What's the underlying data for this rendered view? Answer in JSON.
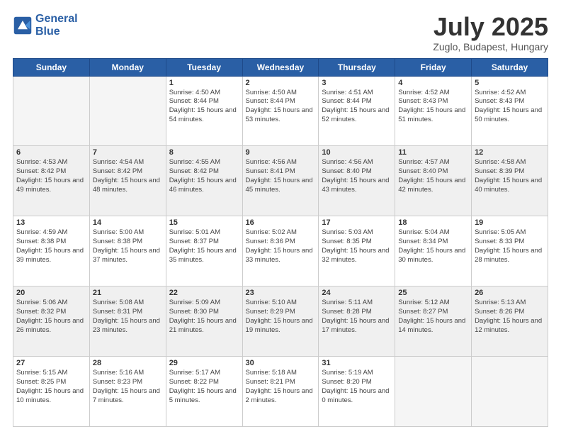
{
  "logo": {
    "line1": "General",
    "line2": "Blue"
  },
  "header": {
    "month_year": "July 2025",
    "location": "Zuglo, Budapest, Hungary"
  },
  "weekdays": [
    "Sunday",
    "Monday",
    "Tuesday",
    "Wednesday",
    "Thursday",
    "Friday",
    "Saturday"
  ],
  "weeks": [
    [
      {
        "day": "",
        "sunrise": "",
        "sunset": "",
        "daylight": ""
      },
      {
        "day": "",
        "sunrise": "",
        "sunset": "",
        "daylight": ""
      },
      {
        "day": "1",
        "sunrise": "Sunrise: 4:50 AM",
        "sunset": "Sunset: 8:44 PM",
        "daylight": "Daylight: 15 hours and 54 minutes."
      },
      {
        "day": "2",
        "sunrise": "Sunrise: 4:50 AM",
        "sunset": "Sunset: 8:44 PM",
        "daylight": "Daylight: 15 hours and 53 minutes."
      },
      {
        "day": "3",
        "sunrise": "Sunrise: 4:51 AM",
        "sunset": "Sunset: 8:44 PM",
        "daylight": "Daylight: 15 hours and 52 minutes."
      },
      {
        "day": "4",
        "sunrise": "Sunrise: 4:52 AM",
        "sunset": "Sunset: 8:43 PM",
        "daylight": "Daylight: 15 hours and 51 minutes."
      },
      {
        "day": "5",
        "sunrise": "Sunrise: 4:52 AM",
        "sunset": "Sunset: 8:43 PM",
        "daylight": "Daylight: 15 hours and 50 minutes."
      }
    ],
    [
      {
        "day": "6",
        "sunrise": "Sunrise: 4:53 AM",
        "sunset": "Sunset: 8:42 PM",
        "daylight": "Daylight: 15 hours and 49 minutes."
      },
      {
        "day": "7",
        "sunrise": "Sunrise: 4:54 AM",
        "sunset": "Sunset: 8:42 PM",
        "daylight": "Daylight: 15 hours and 48 minutes."
      },
      {
        "day": "8",
        "sunrise": "Sunrise: 4:55 AM",
        "sunset": "Sunset: 8:42 PM",
        "daylight": "Daylight: 15 hours and 46 minutes."
      },
      {
        "day": "9",
        "sunrise": "Sunrise: 4:56 AM",
        "sunset": "Sunset: 8:41 PM",
        "daylight": "Daylight: 15 hours and 45 minutes."
      },
      {
        "day": "10",
        "sunrise": "Sunrise: 4:56 AM",
        "sunset": "Sunset: 8:40 PM",
        "daylight": "Daylight: 15 hours and 43 minutes."
      },
      {
        "day": "11",
        "sunrise": "Sunrise: 4:57 AM",
        "sunset": "Sunset: 8:40 PM",
        "daylight": "Daylight: 15 hours and 42 minutes."
      },
      {
        "day": "12",
        "sunrise": "Sunrise: 4:58 AM",
        "sunset": "Sunset: 8:39 PM",
        "daylight": "Daylight: 15 hours and 40 minutes."
      }
    ],
    [
      {
        "day": "13",
        "sunrise": "Sunrise: 4:59 AM",
        "sunset": "Sunset: 8:38 PM",
        "daylight": "Daylight: 15 hours and 39 minutes."
      },
      {
        "day": "14",
        "sunrise": "Sunrise: 5:00 AM",
        "sunset": "Sunset: 8:38 PM",
        "daylight": "Daylight: 15 hours and 37 minutes."
      },
      {
        "day": "15",
        "sunrise": "Sunrise: 5:01 AM",
        "sunset": "Sunset: 8:37 PM",
        "daylight": "Daylight: 15 hours and 35 minutes."
      },
      {
        "day": "16",
        "sunrise": "Sunrise: 5:02 AM",
        "sunset": "Sunset: 8:36 PM",
        "daylight": "Daylight: 15 hours and 33 minutes."
      },
      {
        "day": "17",
        "sunrise": "Sunrise: 5:03 AM",
        "sunset": "Sunset: 8:35 PM",
        "daylight": "Daylight: 15 hours and 32 minutes."
      },
      {
        "day": "18",
        "sunrise": "Sunrise: 5:04 AM",
        "sunset": "Sunset: 8:34 PM",
        "daylight": "Daylight: 15 hours and 30 minutes."
      },
      {
        "day": "19",
        "sunrise": "Sunrise: 5:05 AM",
        "sunset": "Sunset: 8:33 PM",
        "daylight": "Daylight: 15 hours and 28 minutes."
      }
    ],
    [
      {
        "day": "20",
        "sunrise": "Sunrise: 5:06 AM",
        "sunset": "Sunset: 8:32 PM",
        "daylight": "Daylight: 15 hours and 26 minutes."
      },
      {
        "day": "21",
        "sunrise": "Sunrise: 5:08 AM",
        "sunset": "Sunset: 8:31 PM",
        "daylight": "Daylight: 15 hours and 23 minutes."
      },
      {
        "day": "22",
        "sunrise": "Sunrise: 5:09 AM",
        "sunset": "Sunset: 8:30 PM",
        "daylight": "Daylight: 15 hours and 21 minutes."
      },
      {
        "day": "23",
        "sunrise": "Sunrise: 5:10 AM",
        "sunset": "Sunset: 8:29 PM",
        "daylight": "Daylight: 15 hours and 19 minutes."
      },
      {
        "day": "24",
        "sunrise": "Sunrise: 5:11 AM",
        "sunset": "Sunset: 8:28 PM",
        "daylight": "Daylight: 15 hours and 17 minutes."
      },
      {
        "day": "25",
        "sunrise": "Sunrise: 5:12 AM",
        "sunset": "Sunset: 8:27 PM",
        "daylight": "Daylight: 15 hours and 14 minutes."
      },
      {
        "day": "26",
        "sunrise": "Sunrise: 5:13 AM",
        "sunset": "Sunset: 8:26 PM",
        "daylight": "Daylight: 15 hours and 12 minutes."
      }
    ],
    [
      {
        "day": "27",
        "sunrise": "Sunrise: 5:15 AM",
        "sunset": "Sunset: 8:25 PM",
        "daylight": "Daylight: 15 hours and 10 minutes."
      },
      {
        "day": "28",
        "sunrise": "Sunrise: 5:16 AM",
        "sunset": "Sunset: 8:23 PM",
        "daylight": "Daylight: 15 hours and 7 minutes."
      },
      {
        "day": "29",
        "sunrise": "Sunrise: 5:17 AM",
        "sunset": "Sunset: 8:22 PM",
        "daylight": "Daylight: 15 hours and 5 minutes."
      },
      {
        "day": "30",
        "sunrise": "Sunrise: 5:18 AM",
        "sunset": "Sunset: 8:21 PM",
        "daylight": "Daylight: 15 hours and 2 minutes."
      },
      {
        "day": "31",
        "sunrise": "Sunrise: 5:19 AM",
        "sunset": "Sunset: 8:20 PM",
        "daylight": "Daylight: 15 hours and 0 minutes."
      },
      {
        "day": "",
        "sunrise": "",
        "sunset": "",
        "daylight": ""
      },
      {
        "day": "",
        "sunrise": "",
        "sunset": "",
        "daylight": ""
      }
    ]
  ]
}
